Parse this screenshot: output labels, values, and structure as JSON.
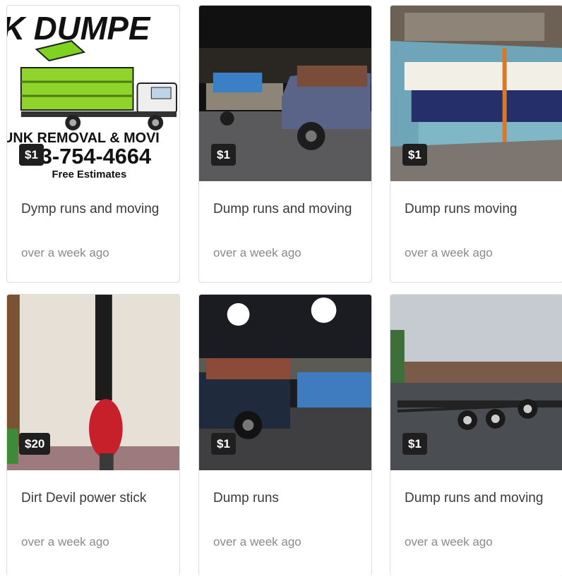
{
  "listings": [
    {
      "price": "$1",
      "title": "Dymp runs and moving",
      "time": "over a week ago",
      "photo": {
        "logo_top": "K DUMPE",
        "logo_line": "UNK REMOVAL & MOVI",
        "logo_phone": "53-754-4664",
        "logo_sub": "Free Estimates"
      }
    },
    {
      "price": "$1",
      "title": "Dump runs and moving",
      "time": "over a week ago"
    },
    {
      "price": "$1",
      "title": "Dump runs moving",
      "time": "over a week ago"
    },
    {
      "price": "$20",
      "title": "Dirt Devil power stick",
      "time": "over a week ago"
    },
    {
      "price": "$1",
      "title": "Dump runs",
      "time": "over a week ago"
    },
    {
      "price": "$1",
      "title": "Dump runs and moving",
      "time": "over a week ago"
    }
  ]
}
